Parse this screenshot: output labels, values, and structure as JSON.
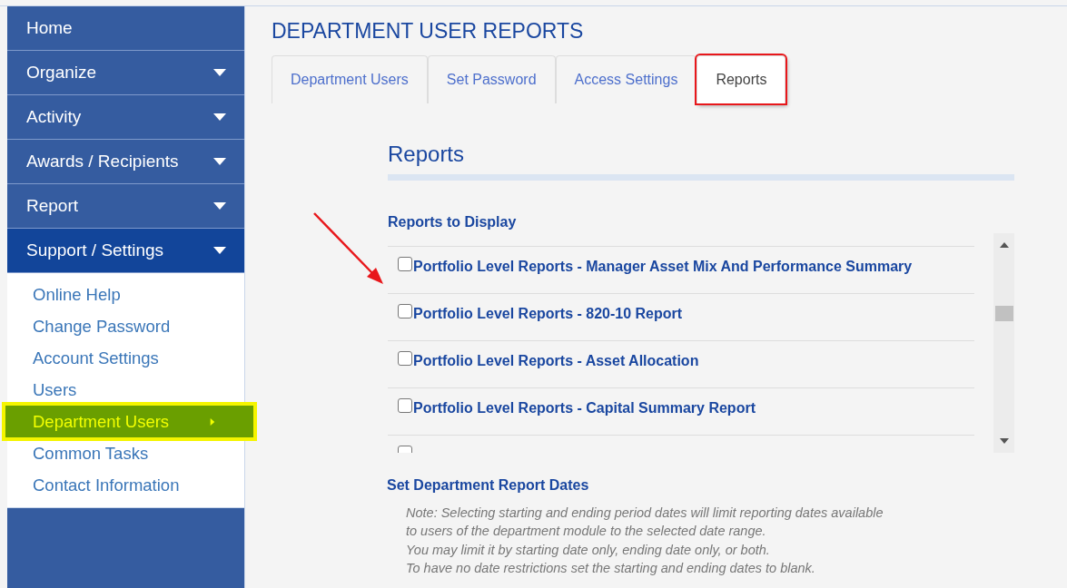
{
  "sidebar": {
    "items": [
      {
        "label": "Home",
        "has_caret": false,
        "expanded": false
      },
      {
        "label": "Organize",
        "has_caret": true,
        "expanded": false
      },
      {
        "label": "Activity",
        "has_caret": true,
        "expanded": false
      },
      {
        "label": "Awards / Recipients",
        "has_caret": true,
        "expanded": false
      },
      {
        "label": "Report",
        "has_caret": true,
        "expanded": false
      },
      {
        "label": "Support / Settings",
        "has_caret": true,
        "expanded": true,
        "children": [
          {
            "label": "Online Help",
            "selected": false
          },
          {
            "label": "Change Password",
            "selected": false
          },
          {
            "label": "Account Settings",
            "selected": false
          },
          {
            "label": "Users",
            "selected": false
          },
          {
            "label": "Department Users",
            "selected": true
          },
          {
            "label": "Common Tasks",
            "selected": false
          },
          {
            "label": "Contact Information",
            "selected": false
          }
        ]
      }
    ]
  },
  "page_title": "DEPARTMENT USER REPORTS",
  "tabs": [
    {
      "label": "Department Users",
      "selected": false,
      "highlighted": false
    },
    {
      "label": "Set Password",
      "selected": false,
      "highlighted": false
    },
    {
      "label": "Access Settings",
      "selected": false,
      "highlighted": false
    },
    {
      "label": "Reports",
      "selected": true,
      "highlighted": true
    }
  ],
  "section_title": "Reports",
  "reports_label": "Reports to Display",
  "annotation_arrow": true,
  "reports": [
    {
      "label": "Portfolio Level Reports - Manager Asset Mix And Performance Summary",
      "checked": false
    },
    {
      "label": "Portfolio Level Reports - 820-10 Report",
      "checked": false
    },
    {
      "label": "Portfolio Level Reports - Asset Allocation",
      "checked": false
    },
    {
      "label": "Portfolio Level Reports - Capital Summary Report",
      "checked": false
    },
    {
      "checked": false
    }
  ],
  "dates_label": "Set Department Report Dates",
  "note_lines": [
    "Note: Selecting starting and ending period dates will limit reporting dates available",
    "to users of the department module to the selected date range.",
    "You may limit it by starting date only, ending date only, or both.",
    "To have no date restrictions set the starting and ending dates to blank."
  ]
}
